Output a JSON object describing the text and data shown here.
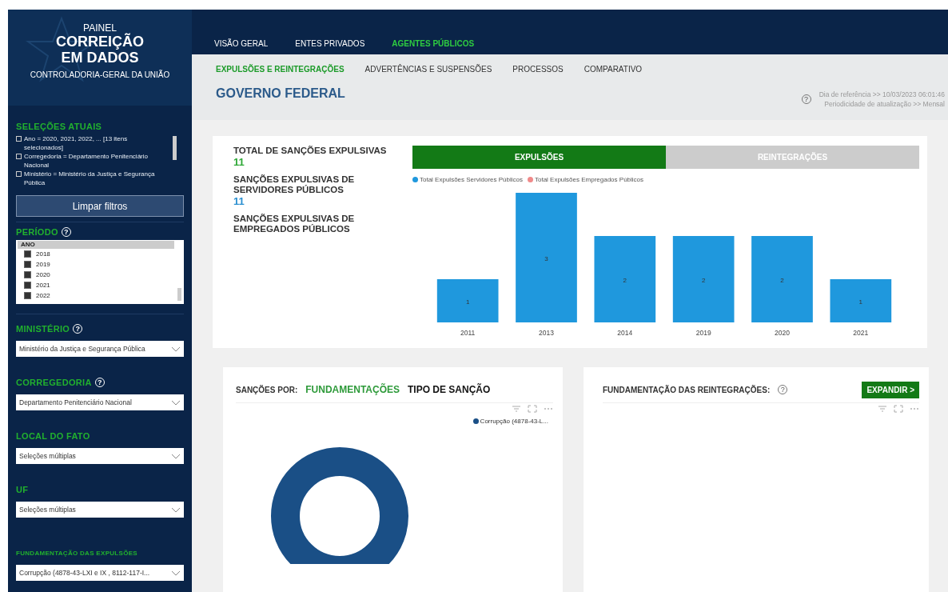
{
  "sidebar": {
    "logo": {
      "kicker": "PAINEL",
      "title_lines": [
        "CORREIÇÃO",
        "EM DADOS"
      ],
      "subtitle": "CONTROLADORIA-GERAL DA UNIÃO"
    },
    "current_selections": {
      "title": "SELEÇÕES ATUAIS",
      "items": [
        "Ano = 2020, 2021, 2022, ... [13 itens selecionados]",
        "Corregedoria = Departamento Penitenciário Nacional",
        "Ministério = Ministério da Justiça e Segurança Pública"
      ]
    },
    "clear_button": "Limpar filtros",
    "period": {
      "title": "PERÍODO",
      "help": "?",
      "list_header": "ANO",
      "years": [
        {
          "label": "2018",
          "checked": true
        },
        {
          "label": "2019",
          "checked": true
        },
        {
          "label": "2020",
          "checked": true
        },
        {
          "label": "2021",
          "checked": true
        },
        {
          "label": "2022",
          "checked": true
        }
      ]
    },
    "filters": [
      {
        "kind": "standard",
        "title": "MINISTÉRIO",
        "help": "?",
        "value": "Ministério da Justiça e Segurança Pública"
      },
      {
        "kind": "standard",
        "title": "CORREGEDORIA",
        "help": "?",
        "value": "Departamento Penitenciário Nacional"
      },
      {
        "kind": "standard",
        "title": "LOCAL DO FATO",
        "value": "Seleções múltiplas"
      },
      {
        "kind": "standard",
        "title": "UF",
        "value": "Seleções múltiplas"
      },
      {
        "kind": "compact",
        "title": "FUNDAMENTAÇÃO DAS EXPULSÕES",
        "value": "Corrupção (4878-43-LXI e IX , 8112-117-I..."
      }
    ]
  },
  "tabs": [
    {
      "label": "VISÃO GERAL",
      "selected": false
    },
    {
      "label": "ENTES PRIVADOS",
      "selected": false
    },
    {
      "label": "AGENTES PÚBLICOS",
      "selected": true
    }
  ],
  "subtabs": [
    {
      "label": "EXPULSÕES E REINTEGRAÇÕES",
      "selected": true
    },
    {
      "label": "ADVERTÊNCIAS E SUSPENSÕES",
      "selected": false
    },
    {
      "label": "PROCESSOS",
      "selected": false
    },
    {
      "label": "COMPARATIVO",
      "selected": false
    }
  ],
  "page_title": "GOVERNO FEDERAL",
  "reference": {
    "help": "?",
    "lines": [
      "Dia de referência >> 10/03/2023 06:01:46",
      "Periodicidade de atualização >> Mensal"
    ]
  },
  "summary_card": {
    "kpis": [
      {
        "label": "TOTAL DE SANÇÕES EXPULSIVAS",
        "value": "11",
        "color": "#2ea836"
      },
      {
        "label": "SANÇÕES EXPULSIVAS DE SERVIDORES PÚBLICOS",
        "value": "11",
        "color": "#2a8fd0"
      },
      {
        "label": "SANÇÕES EXPULSIVAS DE EMPREGADOS PÚBLICOS"
      }
    ],
    "toggle": [
      {
        "label": "EXPULSÕES",
        "selected": true
      },
      {
        "label": "REINTEGRAÇÕES",
        "selected": false
      }
    ],
    "chart_data": {
      "type": "bar",
      "categories": [
        "2011",
        "2013",
        "2014",
        "2019",
        "2020",
        "2021"
      ],
      "series": [
        {
          "name": "Total Expulsões Servidores Públicos",
          "color": "#1f98dd",
          "values": [
            1,
            3,
            2,
            2,
            2,
            1
          ]
        },
        {
          "name": "Total Expulsões Empregados Públicos",
          "color": "#f08a8a",
          "values": [
            null,
            null,
            null,
            null,
            null,
            null
          ]
        }
      ],
      "data_labels": true
    }
  },
  "sanctions_card": {
    "label": "SANÇÕES POR:",
    "options": [
      {
        "label": "FUNDAMENTAÇÕES",
        "selected": true
      },
      {
        "label": "TIPO DE SANÇÃO",
        "selected": false
      }
    ],
    "legend": [
      {
        "label": "Corrupção (4878-43-L...",
        "color": "#1a4f86"
      }
    ]
  },
  "reinstatement_card": {
    "title": "FUNDAMENTAÇÃO DAS REINTEGRAÇÕES:",
    "help": "?",
    "button": "EXPANDIR >"
  }
}
